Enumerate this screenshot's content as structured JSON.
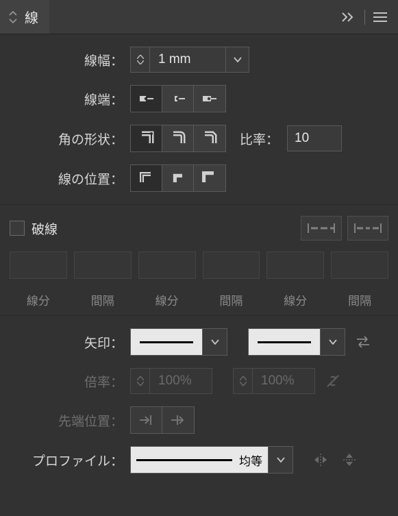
{
  "tab": {
    "title": "線"
  },
  "stroke": {
    "weight_label": "線幅：",
    "weight_value": "1 mm",
    "cap_label": "線端：",
    "corner_label": "角の形状：",
    "ratio_label": "比率：",
    "ratio_value": "10",
    "align_label": "線の位置："
  },
  "dashed": {
    "title": "破線",
    "columns": [
      "線分",
      "間隔",
      "線分",
      "間隔",
      "線分",
      "間隔"
    ]
  },
  "arrow": {
    "label": "矢印：",
    "scale_label": "倍率：",
    "scale_start": "100%",
    "scale_end": "100%",
    "tip_label": "先端位置："
  },
  "profile": {
    "label": "プロファイル：",
    "value": "均等"
  }
}
